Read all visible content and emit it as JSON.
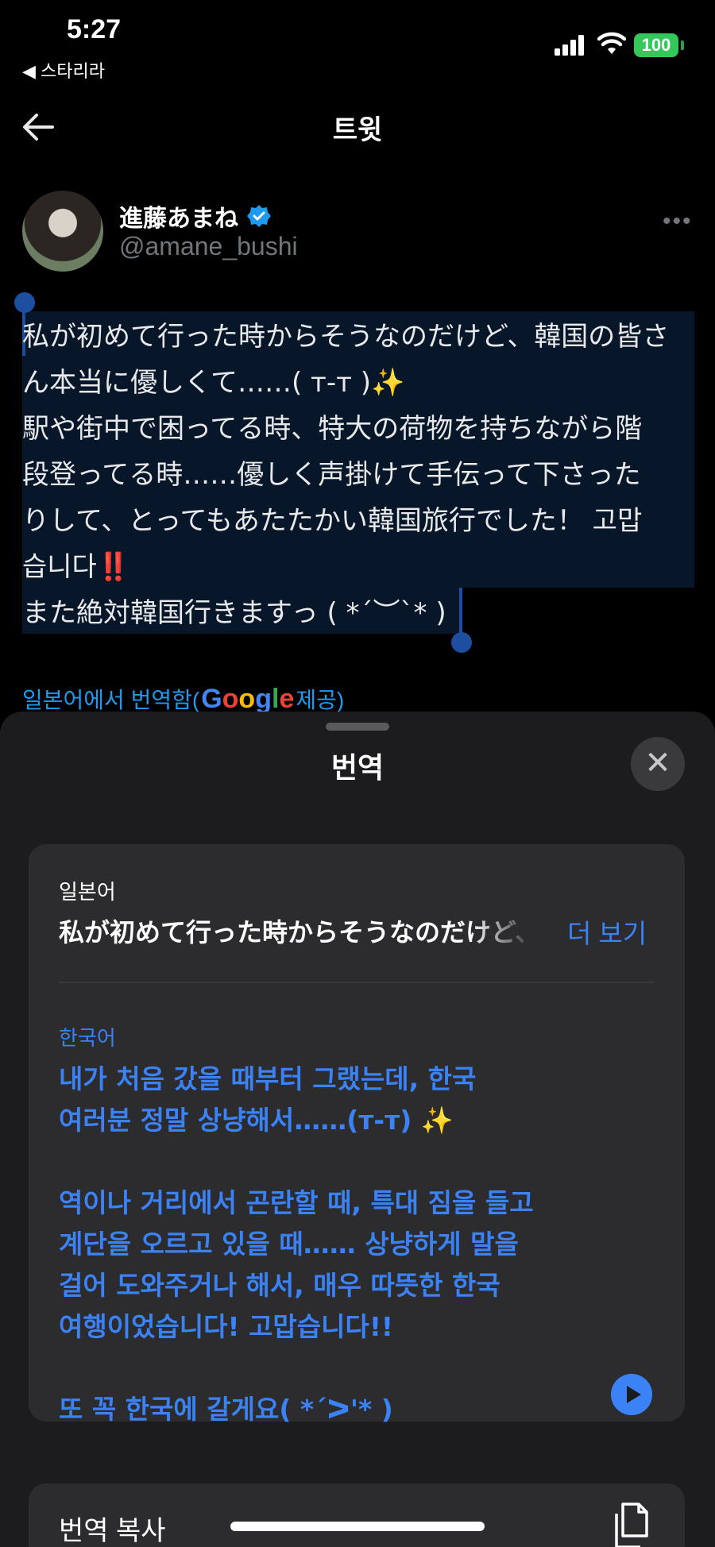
{
  "status_bar": {
    "time": "5:27",
    "back_app": "◀ 스타리라",
    "battery": "100"
  },
  "header": {
    "title": "트윗"
  },
  "tweet": {
    "author_name": "進藤あまね",
    "handle": "@amane_bushi",
    "more": "•••",
    "lines": [
      "私が初めて行った時からそうなのだけど、韓国の皆さ",
      "ん本当に優しくて……( т-т )✨",
      "駅や街中で困ってる時、特大の荷物を持ちながら階",
      "段登ってる時……優しく声掛けて手伝って下さった",
      "りして、とってもあたたかい韓国旅行でした！ 고맙",
      "습니다‼️",
      "また絶対韓国行きますっ ( *´︶`* )"
    ],
    "translated_prefix": "일본어에서 번역함(",
    "translated_brand": "Google",
    "translated_suffix": " 제공)"
  },
  "sheet": {
    "title": "번역",
    "close": "✕",
    "source_language": "일본어",
    "source_text": "私が初めて行った時からそうなのだけど、韓国の皆さん",
    "more_label": "더 보기",
    "target_language": "한국어",
    "target_paragraphs": [
      "내가 처음 갔을 때부터 그랬는데, 한국\n여러분 정말 상냥해서……(т-т) ✨",
      "역이나 거리에서 곤란할 때, 특대 짐을 들고\n계단을 오르고 있을 때…… 상냥하게 말을\n걸어 도와주거나 해서, 매우 따뜻한 한국\n여행이었습니다! 고맙습니다!!",
      "또 꼭 한국에 갈게요( *´ᐳ'* )"
    ],
    "copy_label": "번역 복사"
  }
}
